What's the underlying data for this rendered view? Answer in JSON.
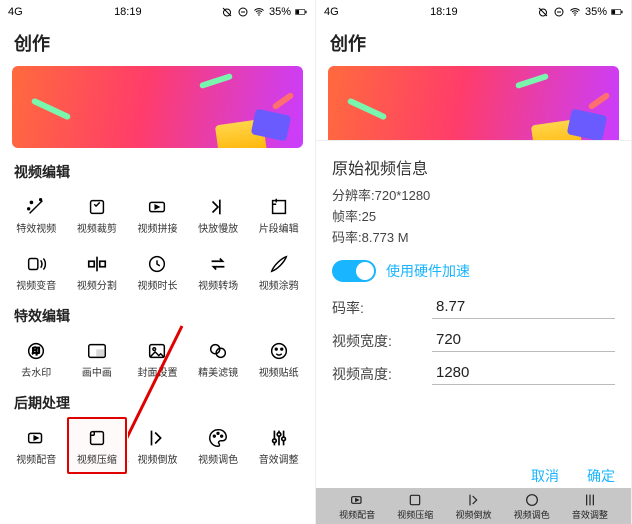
{
  "statusbar": {
    "net": "4G",
    "time": "18:19",
    "battery": "35%"
  },
  "header": {
    "title": "创作"
  },
  "section1": {
    "title": "视频编辑",
    "row1": [
      {
        "label": "特效视频"
      },
      {
        "label": "视频裁剪"
      },
      {
        "label": "视频拼接"
      },
      {
        "label": "快放慢放"
      },
      {
        "label": "片段编辑"
      }
    ],
    "row2": [
      {
        "label": "视频变音"
      },
      {
        "label": "视频分割"
      },
      {
        "label": "视频时长"
      },
      {
        "label": "视频转场"
      },
      {
        "label": "视频涂鸦"
      }
    ]
  },
  "section2": {
    "title": "特效编辑",
    "row": [
      {
        "label": "去水印"
      },
      {
        "label": "画中画"
      },
      {
        "label": "封面设置"
      },
      {
        "label": "精美滤镜"
      },
      {
        "label": "视频贴纸"
      }
    ]
  },
  "section3": {
    "title": "后期处理",
    "row": [
      {
        "label": "视频配音"
      },
      {
        "label": "视频压缩"
      },
      {
        "label": "视频倒放"
      },
      {
        "label": "视频调色"
      },
      {
        "label": "音效调整"
      }
    ]
  },
  "dialog": {
    "title": "原始视频信息",
    "resolution_label": "分辨率:720*1280",
    "fps_label": "帧率:25",
    "bitrate_label": "码率:8.773 M",
    "hw_label": "使用硬件加速",
    "fields": {
      "bitrate_name": "码率:",
      "bitrate_value": "8.77",
      "width_name": "视频宽度:",
      "width_value": "720",
      "height_name": "视频高度:",
      "height_value": "1280"
    },
    "cancel": "取消",
    "confirm": "确定"
  }
}
